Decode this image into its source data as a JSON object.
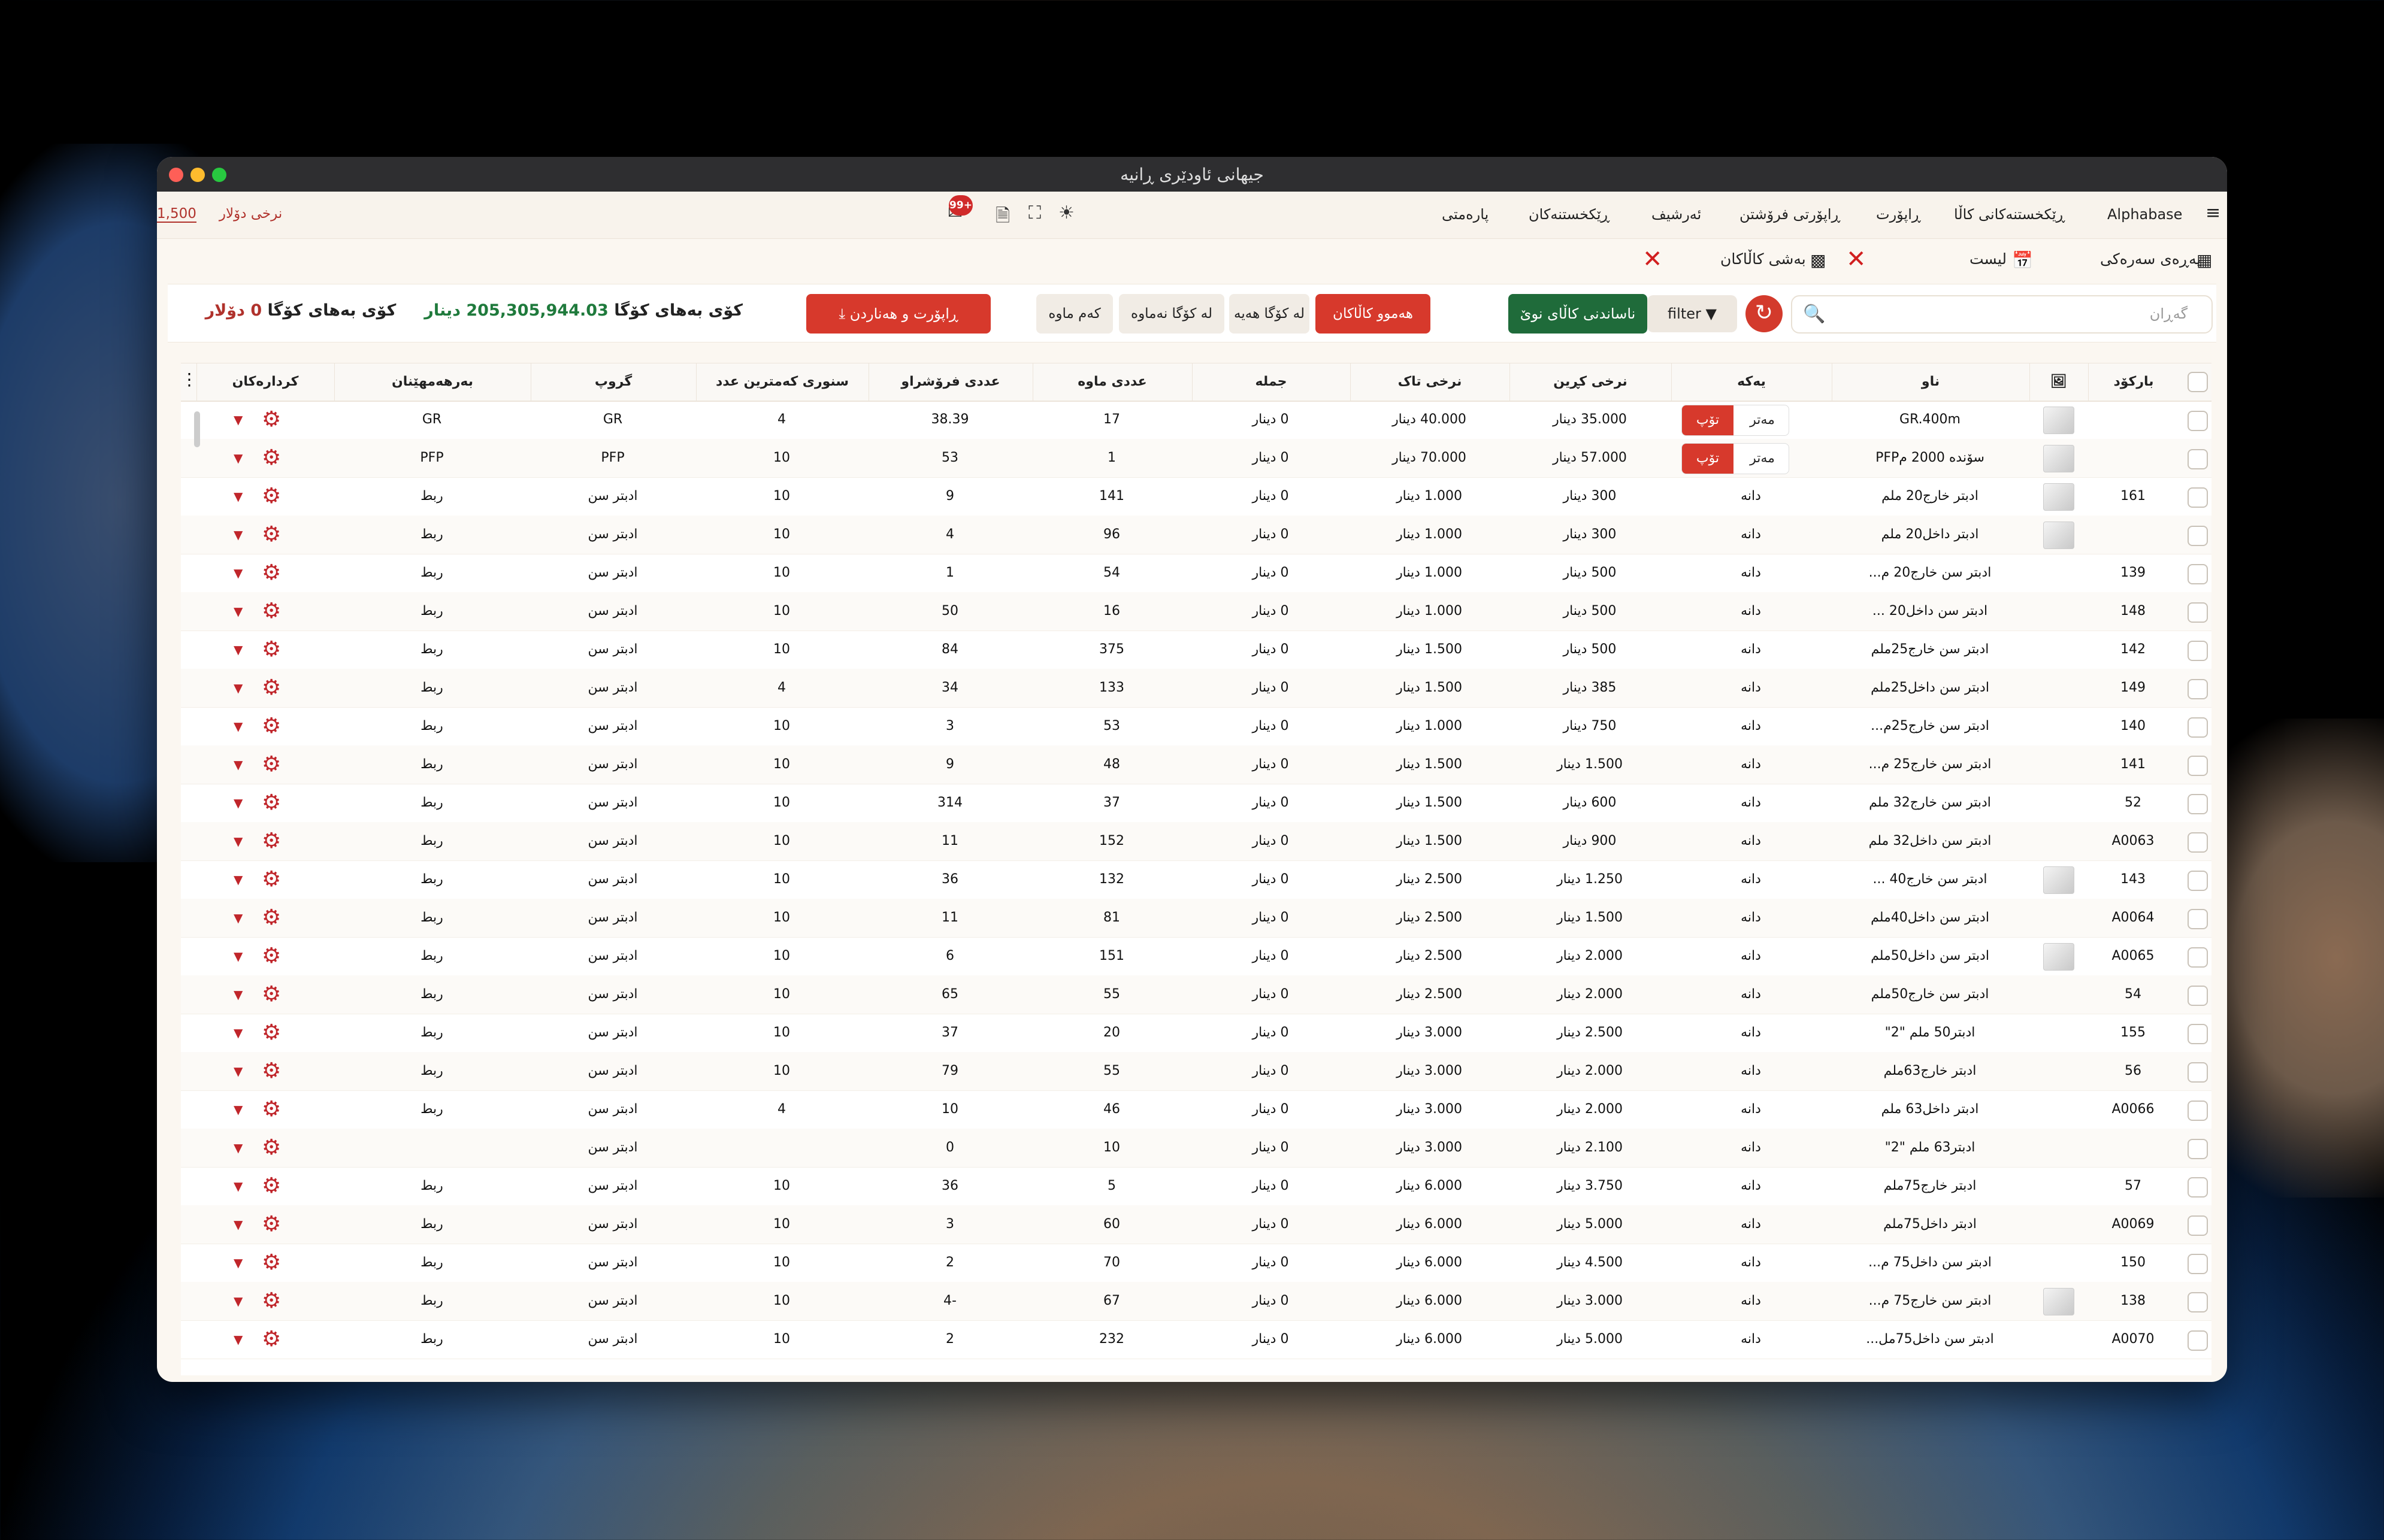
{
  "window": {
    "title": "جیهانی ئاودێری ڕانیە"
  },
  "menu": {
    "items": [
      "Alphabase",
      "ڕێکخستنەکانی کاڵا",
      "ڕاپۆرت",
      "ڕاپۆرتی فرۆشتن",
      "ئەرشیف",
      "ڕێکخستنەکان",
      "پارەمتی"
    ]
  },
  "rate": {
    "label": "نرخی دۆلار",
    "value": "1,500"
  },
  "toolbar": {
    "badge": "99+"
  },
  "subbar": {
    "home": "پەڕەی سەرەکی",
    "list": "لیست",
    "products_section": "بەشی کاڵاکان"
  },
  "actions": {
    "search_placeholder": "گەڕان",
    "filter": "filter",
    "new_item": "ناساندنی کاڵای نوێ",
    "seg_all": "هەموو کاڵاکان",
    "seg_instock": "لە کۆگا هەیە",
    "seg_outstock": "لە کۆگا نەماوە",
    "seg_low": "کەم ماوە",
    "report": "ڕاپۆرت و هەناردن"
  },
  "totals": {
    "label1": "کۆی بەهای کۆگا",
    "value1": "205,305,944.03",
    "unit1": "دینار",
    "label2": "کۆی بەهای کۆگا",
    "value2": "0",
    "unit2": "دۆلار"
  },
  "table": {
    "headers": [
      "بارکۆد",
      "",
      "ناو",
      "یەکە",
      "نرخی کڕین",
      "نرخی تاک",
      "جملە",
      "عددی ماوە",
      "عددی فرۆشراو",
      "سنوری کەمترین عدد",
      "گروپ",
      "بەرهەمهێنان",
      "کردارەکان"
    ],
    "units": {
      "meter": "مەتر",
      "roll": "تۆپ"
    },
    "rows": [
      {
        "barcode": "",
        "thumb": true,
        "name": "GR.400m",
        "unit": "seg",
        "buy": "35.000 دینار",
        "sell": "40.000 دینار",
        "whole": "0 دینار",
        "remain": "17",
        "sold": "38.39",
        "min": "4",
        "group": "GR",
        "maker": "GR"
      },
      {
        "barcode": "",
        "thumb": true,
        "name": "سۆندە 2000 مPFP",
        "unit": "seg",
        "buy": "57.000 دینار",
        "sell": "70.000 دینار",
        "whole": "0 دینار",
        "remain": "1",
        "sold": "53",
        "min": "10",
        "group": "PFP",
        "maker": "PFP"
      },
      {
        "barcode": "161",
        "thumb": true,
        "name": "ادبتر خارج20 ملم",
        "unit": "دانە",
        "buy": "300 دینار",
        "sell": "1.000 دینار",
        "whole": "0 دینار",
        "remain": "141",
        "sold": "9",
        "min": "10",
        "group": "ادبتر سن",
        "maker": "ربط"
      },
      {
        "barcode": "",
        "thumb": true,
        "name": "ادبتر داخل20 ملم",
        "unit": "دانە",
        "buy": "300 دینار",
        "sell": "1.000 دینار",
        "whole": "0 دینار",
        "remain": "96",
        "sold": "4",
        "min": "10",
        "group": "ادبتر سن",
        "maker": "ربط"
      },
      {
        "barcode": "139",
        "thumb": false,
        "name": "ادبتر سن خارج20 م...",
        "unit": "دانە",
        "buy": "500 دینار",
        "sell": "1.000 دینار",
        "whole": "0 دینار",
        "remain": "54",
        "sold": "1",
        "min": "10",
        "group": "ادبتر سن",
        "maker": "ربط"
      },
      {
        "barcode": "148",
        "thumb": false,
        "name": "ادبتر سن داخل20 ...",
        "unit": "دانە",
        "buy": "500 دینار",
        "sell": "1.000 دینار",
        "whole": "0 دینار",
        "remain": "16",
        "sold": "50",
        "min": "10",
        "group": "ادبتر سن",
        "maker": "ربط"
      },
      {
        "barcode": "142",
        "thumb": false,
        "name": "ادبتر سن خارج25ملم",
        "unit": "دانە",
        "buy": "500 دینار",
        "sell": "1.500 دینار",
        "whole": "0 دینار",
        "remain": "375",
        "sold": "84",
        "min": "10",
        "group": "ادبتر سن",
        "maker": "ربط"
      },
      {
        "barcode": "149",
        "thumb": false,
        "name": "ادبتر سن داخل25ملم",
        "unit": "دانە",
        "buy": "385 دینار",
        "sell": "1.500 دینار",
        "whole": "0 دینار",
        "remain": "133",
        "sold": "34",
        "min": "4",
        "group": "ادبتر سن",
        "maker": "ربط"
      },
      {
        "barcode": "140",
        "thumb": false,
        "name": "ادبتر سن خارج25م...",
        "unit": "دانە",
        "buy": "750 دینار",
        "sell": "1.000 دینار",
        "whole": "0 دینار",
        "remain": "53",
        "sold": "3",
        "min": "10",
        "group": "ادبتر سن",
        "maker": "ربط"
      },
      {
        "barcode": "141",
        "thumb": false,
        "name": "ادبتر سن خارج25 م...",
        "unit": "دانە",
        "buy": "1.500 دینار",
        "sell": "1.500 دینار",
        "whole": "0 دینار",
        "remain": "48",
        "sold": "9",
        "min": "10",
        "group": "ادبتر سن",
        "maker": "ربط"
      },
      {
        "barcode": "52",
        "thumb": false,
        "name": "ادبتر سن خارج32 ملم",
        "unit": "دانە",
        "buy": "600 دینار",
        "sell": "1.500 دینار",
        "whole": "0 دینار",
        "remain": "37",
        "sold": "314",
        "min": "10",
        "group": "ادبتر سن",
        "maker": "ربط"
      },
      {
        "barcode": "A0063",
        "thumb": false,
        "name": "ادبتر سن داخل32 ملم",
        "unit": "دانە",
        "buy": "900 دینار",
        "sell": "1.500 دینار",
        "whole": "0 دینار",
        "remain": "152",
        "sold": "11",
        "min": "10",
        "group": "ادبتر سن",
        "maker": "ربط"
      },
      {
        "barcode": "143",
        "thumb": true,
        "name": "ادبتر سن خارج40 ...",
        "unit": "دانە",
        "buy": "1.250 دینار",
        "sell": "2.500 دینار",
        "whole": "0 دینار",
        "remain": "132",
        "sold": "36",
        "min": "10",
        "group": "ادبتر سن",
        "maker": "ربط"
      },
      {
        "barcode": "A0064",
        "thumb": false,
        "name": "ادبتر سن داخل40ملم",
        "unit": "دانە",
        "buy": "1.500 دینار",
        "sell": "2.500 دینار",
        "whole": "0 دینار",
        "remain": "81",
        "sold": "11",
        "min": "10",
        "group": "ادبتر سن",
        "maker": "ربط"
      },
      {
        "barcode": "A0065",
        "thumb": true,
        "name": "ادبتر سن داخل50ملم",
        "unit": "دانە",
        "buy": "2.000 دینار",
        "sell": "2.500 دینار",
        "whole": "0 دینار",
        "remain": "151",
        "sold": "6",
        "min": "10",
        "group": "ادبتر سن",
        "maker": "ربط"
      },
      {
        "barcode": "54",
        "thumb": false,
        "name": "ادبتر سن خارج50ملم",
        "unit": "دانە",
        "buy": "2.000 دینار",
        "sell": "2.500 دینار",
        "whole": "0 دینار",
        "remain": "55",
        "sold": "65",
        "min": "10",
        "group": "ادبتر سن",
        "maker": "ربط"
      },
      {
        "barcode": "155",
        "thumb": false,
        "name": "ادبتر50 ملم \"2\"",
        "unit": "دانە",
        "buy": "2.500 دینار",
        "sell": "3.000 دینار",
        "whole": "0 دینار",
        "remain": "20",
        "sold": "37",
        "min": "10",
        "group": "ادبتر سن",
        "maker": "ربط"
      },
      {
        "barcode": "56",
        "thumb": false,
        "name": "ادبتر خارج63ملم",
        "unit": "دانە",
        "buy": "2.000 دینار",
        "sell": "3.000 دینار",
        "whole": "0 دینار",
        "remain": "55",
        "sold": "79",
        "min": "10",
        "group": "ادبتر سن",
        "maker": "ربط"
      },
      {
        "barcode": "A0066",
        "thumb": false,
        "name": "ادبتر داخل63 ملم",
        "unit": "دانە",
        "buy": "2.000 دینار",
        "sell": "3.000 دینار",
        "whole": "0 دینار",
        "remain": "46",
        "sold": "10",
        "min": "4",
        "group": "ادبتر سن",
        "maker": "ربط"
      },
      {
        "barcode": "",
        "thumb": false,
        "name": "ادبتر63 ملم \"2\"",
        "unit": "دانە",
        "buy": "2.100 دینار",
        "sell": "3.000 دینار",
        "whole": "0 دینار",
        "remain": "10",
        "sold": "0",
        "min": "",
        "group": "ادبتر سن",
        "maker": ""
      },
      {
        "barcode": "57",
        "thumb": false,
        "name": "ادبتر خارج75ملم",
        "unit": "دانە",
        "buy": "3.750 دینار",
        "sell": "6.000 دینار",
        "whole": "0 دینار",
        "remain": "5",
        "sold": "36",
        "min": "10",
        "group": "ادبتر سن",
        "maker": "ربط"
      },
      {
        "barcode": "A0069",
        "thumb": false,
        "name": "ادبتر داخل75ملم",
        "unit": "دانە",
        "buy": "5.000 دینار",
        "sell": "6.000 دینار",
        "whole": "0 دینار",
        "remain": "60",
        "sold": "3",
        "min": "10",
        "group": "ادبتر سن",
        "maker": "ربط"
      },
      {
        "barcode": "150",
        "thumb": false,
        "name": "ادبتر سن داخل75 م...",
        "unit": "دانە",
        "buy": "4.500 دینار",
        "sell": "6.000 دینار",
        "whole": "0 دینار",
        "remain": "70",
        "sold": "2",
        "min": "10",
        "group": "ادبتر سن",
        "maker": "ربط"
      },
      {
        "barcode": "138",
        "thumb": true,
        "name": "ادبتر سن خارج75 م...",
        "unit": "دانە",
        "buy": "3.000 دینار",
        "sell": "6.000 دینار",
        "whole": "0 دینار",
        "remain": "67",
        "sold": "-4",
        "min": "10",
        "group": "ادبتر سن",
        "maker": "ربط"
      },
      {
        "barcode": "A0070",
        "thumb": false,
        "name": "ادبتر سن داخل75مل...",
        "unit": "دانە",
        "buy": "5.000 دینار",
        "sell": "6.000 دینار",
        "whole": "0 دینار",
        "remain": "232",
        "sold": "2",
        "min": "10",
        "group": "ادبتر سن",
        "maker": "ربط"
      }
    ]
  }
}
